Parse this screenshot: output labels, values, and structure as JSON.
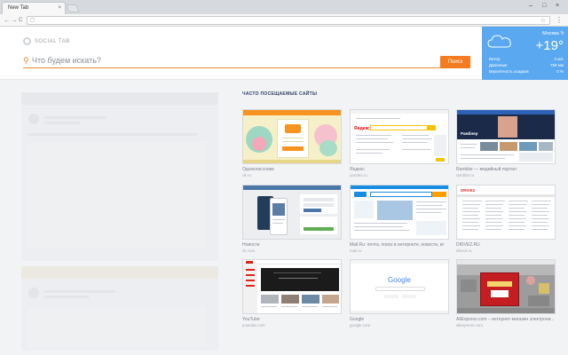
{
  "browser": {
    "tab_title": "New Tab",
    "tab_close": "×",
    "window_controls": [
      "–",
      "□",
      "×"
    ],
    "back": "←",
    "forward": "→",
    "reload": "C",
    "menu": "⋮"
  },
  "header": {
    "logo_text": "SOCIAL TAB",
    "search_placeholder": "Что будем искать?",
    "search_button": "Поиск"
  },
  "weather": {
    "city": "Москва",
    "temperature": "+19°",
    "rows": [
      {
        "label": "Ветер",
        "value": "2 м/с"
      },
      {
        "label": "Давление",
        "value": "759 мм"
      },
      {
        "label": "Вероятность осадков",
        "value": "0 %"
      }
    ]
  },
  "most_visited": {
    "title": "ЧАСТО ПОСЕЩАЕМЫЕ САЙТЫ",
    "tiles": [
      {
        "title": "Одноклассники",
        "url": "ok.ru"
      },
      {
        "title": "Яндекс",
        "url": "yandex.ru"
      },
      {
        "title": "Rambler — медийный портал",
        "url": "rambler.ru"
      },
      {
        "title": "Новости",
        "url": "vk.com"
      },
      {
        "title": "Mail.Ru: почта, поиск в интернете, новости, иг",
        "url": "mail.ru"
      },
      {
        "title": "DRIVE2.RU",
        "url": "drive2.ru"
      },
      {
        "title": "YouTube",
        "url": "youtube.com"
      },
      {
        "title": "Google",
        "url": "google.com"
      },
      {
        "title": "AliExpress.com – интернет-магазин электрони...",
        "url": "aliexpress.com"
      }
    ]
  },
  "thumb_text": {
    "google_logo": "Google",
    "yandex_logo": "Яндекс",
    "rambler_logo": "Рамблер",
    "drive2_logo": "DRIVE2"
  },
  "colors": {
    "accent": "#f47b20",
    "weather_bg": "#5aa9f0",
    "vk_blue": "#4a76a8",
    "mailru_blue": "#168de2",
    "youtube_red": "#e62117",
    "ali_red": "#c41e22"
  }
}
